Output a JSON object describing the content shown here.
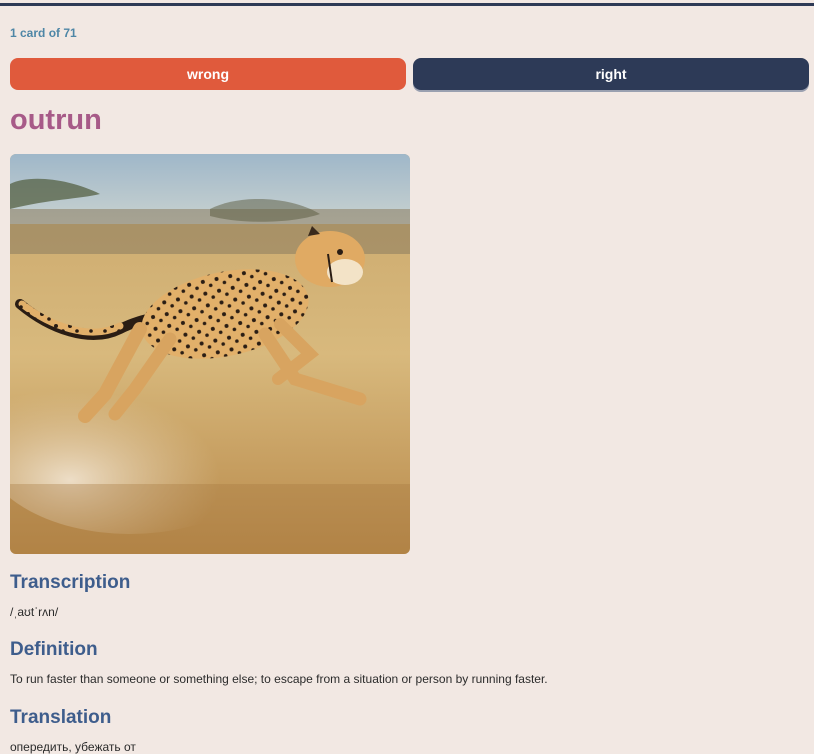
{
  "progress": {
    "counter_text": "1 card of 71"
  },
  "actions": {
    "wrong_label": "wrong",
    "right_label": "right"
  },
  "card": {
    "word": "outrun",
    "image_description_icon": "cheetah-illustration",
    "sections": {
      "transcription": {
        "title": "Transcription",
        "text": "/ˌaʊtˈrʌn/"
      },
      "definition": {
        "title": "Definition",
        "text": "To run faster than someone or something else; to escape from a situation or person by running faster."
      },
      "translation": {
        "title": "Translation",
        "text": "опередить, убежать от"
      }
    }
  },
  "colors": {
    "background": "#f2e8e3",
    "wrong_button": "#e05a3c",
    "right_button": "#2d3a57",
    "word": "#a75a88",
    "section_title": "#3e5d8c",
    "counter": "#4e86a6"
  }
}
